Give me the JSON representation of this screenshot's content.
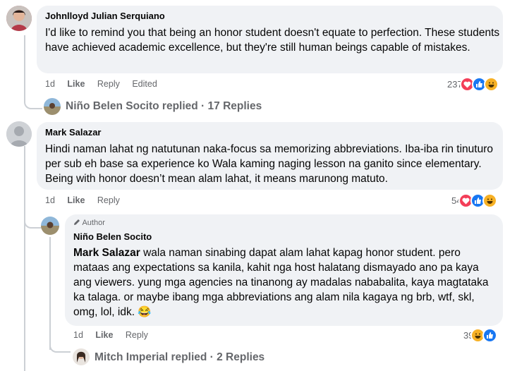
{
  "comments": [
    {
      "author": "Johnlloyd Julian Serquiano",
      "text": "I'd like to remind you that being an honor student doesn't equate to perfection. These students have achieved academic excellence, but they're still human beings capable of mistakes.",
      "time": "1d",
      "like": "Like",
      "reply": "Reply",
      "edited": "Edited",
      "reaction_count": "237",
      "replies_link": "Niño Belen Socito replied · 17 Replies"
    },
    {
      "author": "Mark Salazar",
      "text": "Hindi naman lahat ng natutunan naka-focus sa memorizing abbreviations. Iba-iba rin tinuturo per sub eh base sa experience ko Wala kaming naging lesson na ganito since elementary. Being with honor doesn’t mean alam lahat, it means marunong matuto.",
      "time": "1d",
      "like": "Like",
      "reply": "Reply",
      "reaction_count": "54"
    }
  ],
  "reply": {
    "badge": "Author",
    "author": "Niño Belen Socito",
    "mention": "Mark Salazar",
    "text": " wala naman sinabing dapat alam lahat kapag honor student. pero mataas ang expectations sa kanila, kahit nga host halatang dismayado ano pa kaya ang viewers. yung mga agencies na tinanong ay madalas nababalita, kaya magtataka ka talaga. or maybe ibang mga abbreviations ang alam nila kagaya ng brb, wtf, skl, omg, lol, idk.",
    "emoji": "😂",
    "time": "1d",
    "like": "Like",
    "reply": "Reply",
    "reaction_count": "39",
    "replies_link": "Mitch Imperial replied · 2 Replies"
  },
  "colors": {
    "like_blue": "#1877f2",
    "love_red": "#f33e58",
    "haha_yellow": "#f7b125",
    "bubble": "#f0f2f5",
    "meta": "#65676b"
  }
}
